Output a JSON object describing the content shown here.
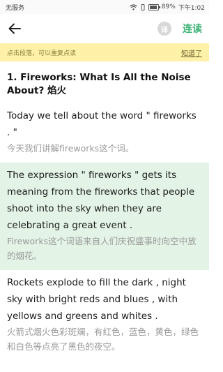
{
  "status_bar": {
    "carrier": "无服务",
    "battery": "89%",
    "battery_level": 0.89,
    "time": "下午1:02"
  },
  "app_bar": {
    "translate_icon_label": "译",
    "continuous_read_label": "连读"
  },
  "hint_bar": {
    "text": "点击段落，可以重复点读",
    "ack_label": "知道了"
  },
  "lesson": {
    "title": "1. Fireworks: What Is All the Noise About? 焰火",
    "paragraphs": [
      {
        "en": "Today we tell about the word \" fireworks . \"",
        "zh": "今天我们讲解fireworks这个词。"
      },
      {
        "en": "The expression \" fireworks \" gets its meaning from the fireworks that people shoot into the sky when they are celebrating a great event .",
        "zh": "Fireworks这个词语来自人们庆祝盛事时向空中放的烟花。"
      },
      {
        "en": "Rockets explode to fill the dark , night sky with bright reds and blues , with yellows and greens and whites .",
        "zh": "火箭式烟火色彩斑斓，有红色，蓝色，黄色，绿色和白色等点亮了黑色的夜空。"
      }
    ]
  },
  "colors": {
    "accent": "#3bb273",
    "hint_bg": "#fff2a8",
    "highlight_bg": "#e3f4e6"
  }
}
